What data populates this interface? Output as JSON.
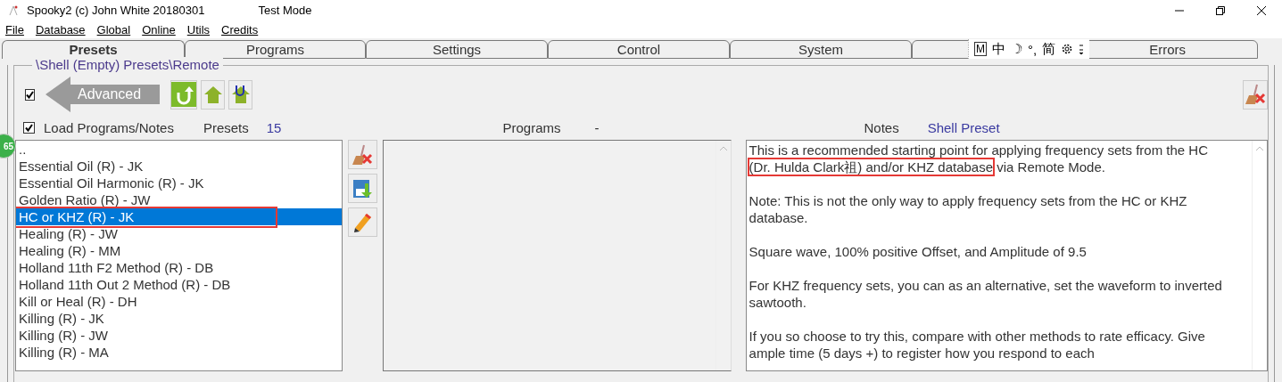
{
  "window": {
    "title": "Spooky2 (c) John White 20180301",
    "mode": "Test Mode"
  },
  "menu": [
    "File",
    "Database",
    "Global",
    "Online",
    "Utils",
    "Credits"
  ],
  "tabs": [
    {
      "label": "Presets",
      "selected": true
    },
    {
      "label": "Programs",
      "selected": false
    },
    {
      "label": "Settings",
      "selected": false
    },
    {
      "label": "Control",
      "selected": false
    },
    {
      "label": "System",
      "selected": false
    },
    {
      "label": "Errors",
      "selected": false
    }
  ],
  "ime_toolbar": [
    "M",
    "中",
    "☽",
    "°,",
    "简"
  ],
  "badge": "65",
  "path": "\\Shell (Empty) Presets\\Remote",
  "advanced": {
    "checked": true,
    "label": "Advanced"
  },
  "load_programs": {
    "checked": true,
    "label": "Load Programs/Notes"
  },
  "presets": {
    "label": "Presets",
    "count": "15",
    "items": [
      {
        "label": "..",
        "selected": false,
        "boxed": false
      },
      {
        "label": "Essential Oil (R) - JK",
        "selected": false,
        "boxed": false
      },
      {
        "label": "Essential Oil Harmonic (R) - JK",
        "selected": false,
        "boxed": false
      },
      {
        "label": "Golden Ratio (R) - JW",
        "selected": false,
        "boxed": false
      },
      {
        "label": "HC or KHZ (R) - JK",
        "selected": true,
        "boxed": true
      },
      {
        "label": "Healing (R) - JW",
        "selected": false,
        "boxed": false
      },
      {
        "label": "Healing (R) - MM",
        "selected": false,
        "boxed": false
      },
      {
        "label": "Holland 11th F2 Method (R) - DB",
        "selected": false,
        "boxed": false
      },
      {
        "label": "Holland 11th Out 2 Method (R) - DB",
        "selected": false,
        "boxed": false
      },
      {
        "label": "Kill or Heal (R) - DH",
        "selected": false,
        "boxed": false
      },
      {
        "label": "Killing (R) - JK",
        "selected": false,
        "boxed": false
      },
      {
        "label": "Killing (R) - JW",
        "selected": false,
        "boxed": false
      },
      {
        "label": "Killing (R) - MA",
        "selected": false,
        "boxed": false
      }
    ]
  },
  "programs": {
    "label": "Programs",
    "count": "-"
  },
  "notes": {
    "label": "Notes",
    "name": "Shell Preset",
    "paragraphs": [
      [
        {
          "text": "This is a recommended starting point for applying frequency sets from the HC ",
          "boxed": false
        },
        {
          "text": "(Dr. Hulda Clark祖) and/or KHZ database",
          "boxed": true
        },
        {
          "text": " via Remote Mode.",
          "boxed": false
        }
      ],
      [
        {
          "text": "Note: This is not the only way to apply frequency sets from the HC or KHZ database.",
          "boxed": false
        }
      ],
      [
        {
          "text": "Square wave, 100% positive Offset, and Amplitude of 9.5",
          "boxed": false
        }
      ],
      [
        {
          "text": "For KHZ frequency sets, you can as an alternative, set the waveform to inverted sawtooth.",
          "boxed": false
        }
      ],
      [
        {
          "text": "If you so choose to try this, compare with other methods to rate efficacy. Give ample time (5 days +) to register how you respond to each",
          "boxed": false
        }
      ]
    ]
  }
}
